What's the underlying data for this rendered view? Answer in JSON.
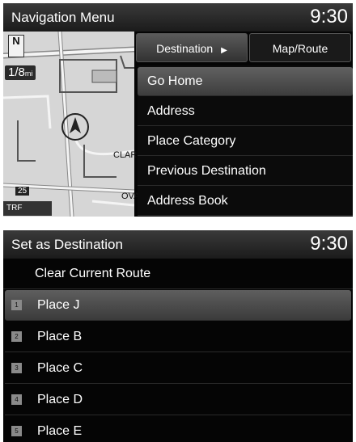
{
  "nav_screen": {
    "title": "Navigation Menu",
    "clock": "9:30",
    "map": {
      "north_label": "N",
      "scale_value": "1/8",
      "scale_unit": "mi",
      "streets": [
        "CLAR",
        "OVA"
      ],
      "route_shield": "25",
      "traffic_label": "TRF"
    },
    "tabs": [
      {
        "label": "Destination",
        "selected": true,
        "arrow": "▶"
      },
      {
        "label": "Map/Route",
        "selected": false
      }
    ],
    "menu_items": [
      {
        "label": "Go Home",
        "selected": true
      },
      {
        "label": "Address"
      },
      {
        "label": "Place Category"
      },
      {
        "label": "Previous Destination"
      },
      {
        "label": "Address Book"
      }
    ]
  },
  "dest_screen": {
    "title": "Set as Destination",
    "clock": "9:30",
    "clear_route_label": "Clear Current Route",
    "places": [
      {
        "badge": "1",
        "label": "Place J",
        "selected": true
      },
      {
        "badge": "2",
        "label": "Place B"
      },
      {
        "badge": "3",
        "label": "Place C"
      },
      {
        "badge": "4",
        "label": "Place D"
      },
      {
        "badge": "5",
        "label": "Place E"
      }
    ]
  }
}
